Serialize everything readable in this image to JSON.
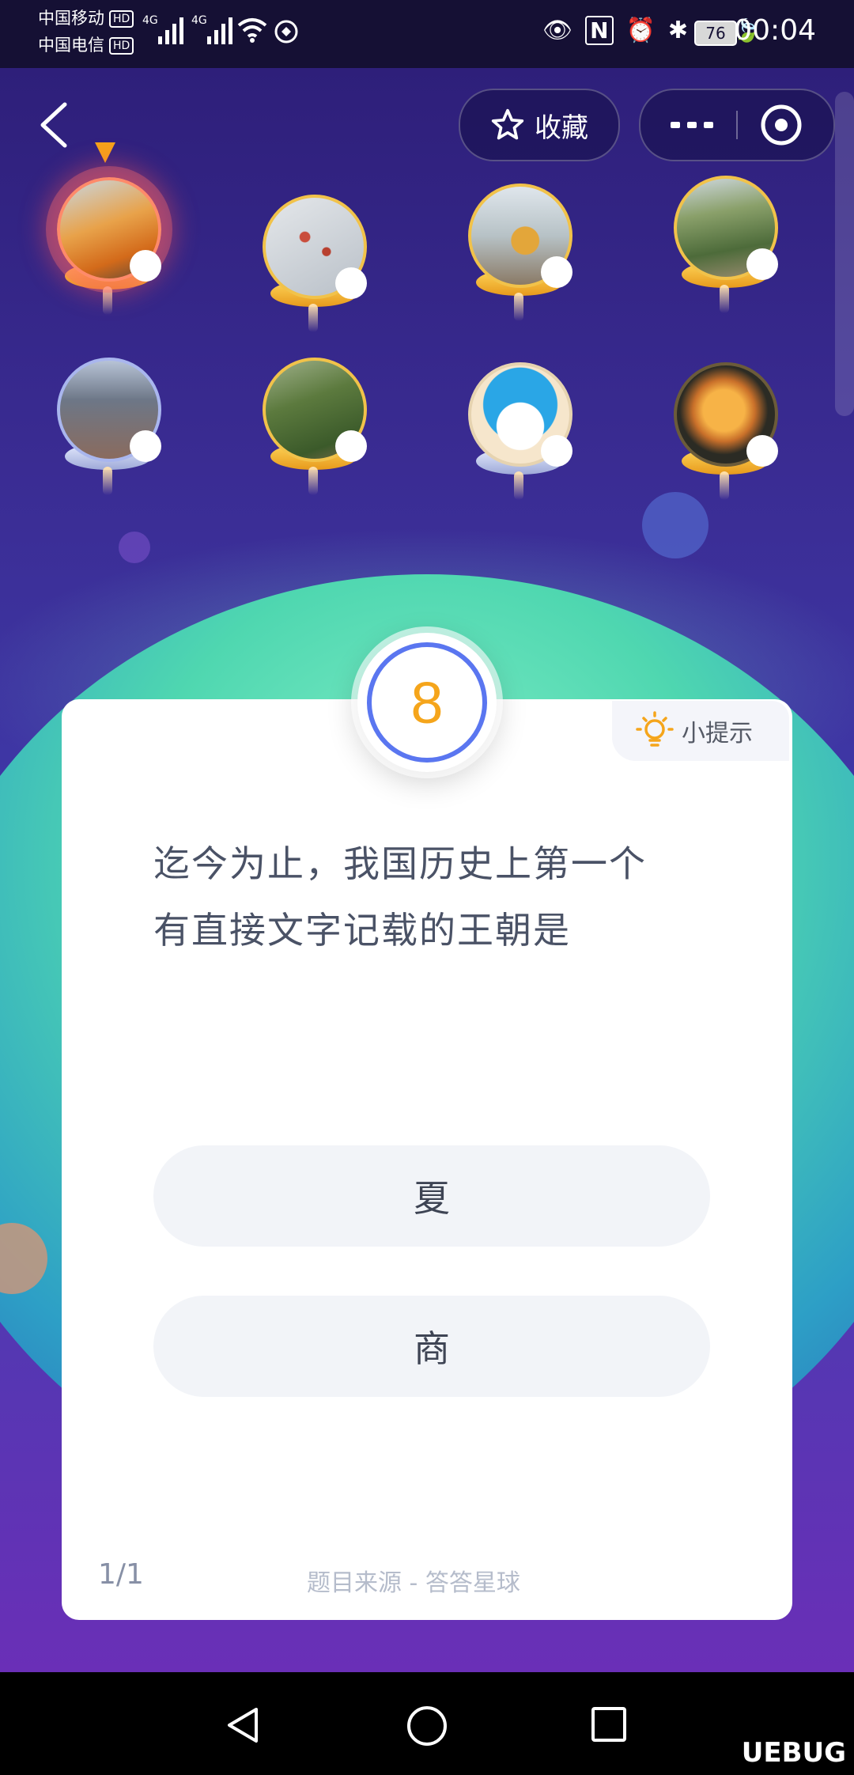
{
  "status_bar": {
    "carrier1": "中国移动",
    "carrier2": "中国电信",
    "hd_label": "HD",
    "network1": "4G",
    "network2": "4G",
    "battery": "76",
    "time": "00:04"
  },
  "nav": {
    "favorite_label": "收藏"
  },
  "avatars": [
    {
      "name": "child-photo",
      "active": true,
      "base": "gold"
    },
    {
      "name": "berries-branch",
      "active": false,
      "base": "gold"
    },
    {
      "name": "pineapple-beach",
      "active": false,
      "base": "gold"
    },
    {
      "name": "great-wall",
      "active": false,
      "base": "gold"
    },
    {
      "name": "building",
      "active": false,
      "base": "silver"
    },
    {
      "name": "tree-foliage",
      "active": false,
      "base": "gold"
    },
    {
      "name": "doraemon",
      "active": false,
      "base": "silver"
    },
    {
      "name": "rose",
      "active": false,
      "base": "gold"
    }
  ],
  "question": {
    "number": "8",
    "hint_label": "小提示",
    "line1": "迄今为止，我国历史上第一个",
    "line2": "有直接文字记载的王朝是",
    "options": [
      "夏",
      "商"
    ],
    "progress": "1/1",
    "source": "题目来源 - 答答星球"
  },
  "watermark": "UEBUG"
}
